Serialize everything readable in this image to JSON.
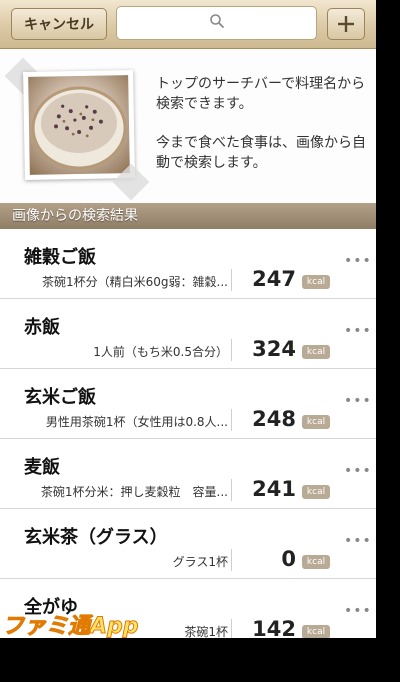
{
  "navbar": {
    "cancel_label": "キャンセル",
    "add_icon": "plus-icon",
    "search_icon": "search-icon"
  },
  "info": {
    "line1": "トップのサーチバーで料理名から検索できます。",
    "line2": "今まで食べた食事は、画像から自動で検索します。"
  },
  "section": {
    "title": "画像からの検索結果"
  },
  "results": [
    {
      "name": "雑穀ご飯",
      "portion": "茶碗1杯分（精白米60g弱：雑穀...",
      "kcal": "247",
      "unit": "kcal",
      "more": "•••"
    },
    {
      "name": "赤飯",
      "portion": "1人前（もち米0.5合分）",
      "kcal": "324",
      "unit": "kcal",
      "more": "•••"
    },
    {
      "name": "玄米ご飯",
      "portion": "男性用茶碗1杯（女性用は0.8人...",
      "kcal": "248",
      "unit": "kcal",
      "more": "•••"
    },
    {
      "name": "麦飯",
      "portion": "茶碗1杯分米：押し麦穀粒　容量...",
      "kcal": "241",
      "unit": "kcal",
      "more": "•••"
    },
    {
      "name": "玄米茶（グラス）",
      "portion": "グラス1杯",
      "kcal": "0",
      "unit": "kcal",
      "more": "•••"
    },
    {
      "name": "全がゆ",
      "portion": "茶碗1杯",
      "kcal": "142",
      "unit": "kcal",
      "more": "•••"
    }
  ],
  "watermark": "ファミ通App",
  "colors": {
    "navbar": "#dccaa6",
    "section_header": "#9f8d76",
    "kcal_badge": "#b9aa95"
  }
}
